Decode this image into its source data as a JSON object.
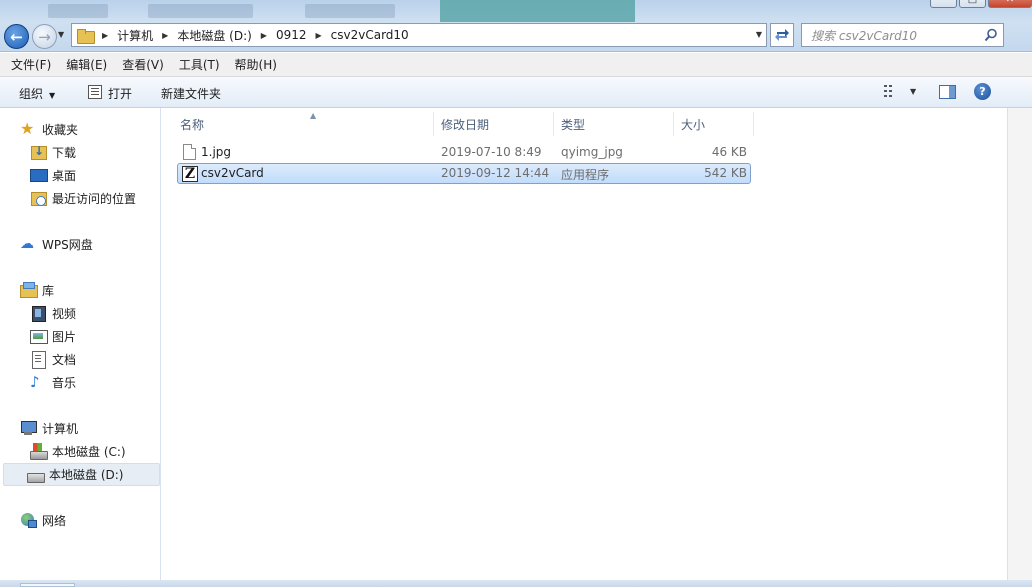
{
  "titlebar": {
    "minimize": "–",
    "maximize": "□",
    "close": "✕"
  },
  "nav": {
    "back": "←",
    "forward": "→"
  },
  "address": {
    "crumbs": [
      "计算机",
      "本地磁盘 (D:)",
      "0912",
      "csv2vCard10"
    ]
  },
  "search": {
    "placeholder": "搜索 csv2vCard10"
  },
  "menubar": {
    "file": "文件(F)",
    "edit": "编辑(E)",
    "view": "查看(V)",
    "tools": "工具(T)",
    "help": "帮助(H)"
  },
  "toolbar": {
    "organize": "组织",
    "open": "打开",
    "new_folder": "新建文件夹",
    "help_glyph": "?"
  },
  "navpane": {
    "favorites": "收藏夹",
    "downloads": "下载",
    "desktop": "桌面",
    "recent": "最近访问的位置",
    "wps": "WPS网盘",
    "library": "库",
    "videos": "视频",
    "pictures": "图片",
    "documents": "文档",
    "music": "音乐",
    "computer": "计算机",
    "drive_c": "本地磁盘 (C:)",
    "drive_d": "本地磁盘 (D:)",
    "network": "网络"
  },
  "columns": {
    "name": "名称",
    "modified": "修改日期",
    "type": "类型",
    "size": "大小"
  },
  "files": [
    {
      "name": "1.jpg",
      "modified": "2019-07-10 8:49",
      "type": "qyimg_jpg",
      "size": "46 KB",
      "icon": "file-icon"
    },
    {
      "name": "csv2vCard",
      "modified": "2019-09-12 14:44",
      "type": "应用程序",
      "size": "542 KB",
      "icon": "app-icon",
      "selected": true
    }
  ],
  "colors": {
    "selection": "#c1dcfc",
    "accent": "#1d5fb4"
  }
}
